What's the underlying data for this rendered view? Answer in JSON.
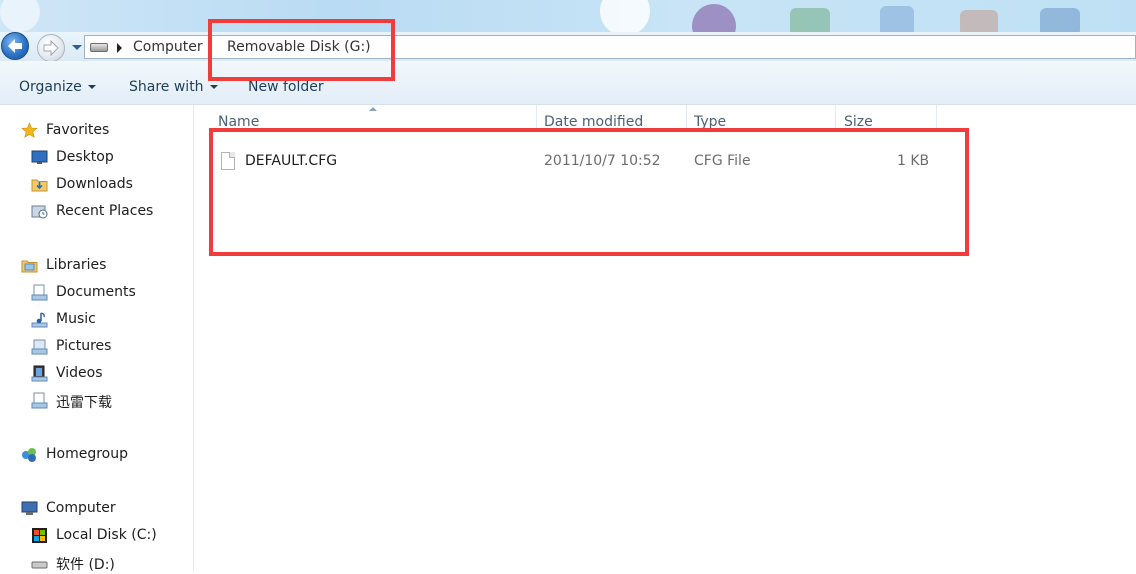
{
  "address": {
    "crumbs": [
      "Computer",
      "Removable Disk (G:)"
    ]
  },
  "toolbar": {
    "organize_label": "Organize",
    "share_label": "Share with",
    "new_folder_label": "New folder"
  },
  "sidebar": {
    "favorites": {
      "label": "Favorites",
      "items": [
        {
          "label": "Desktop",
          "icon": "desktop-icon"
        },
        {
          "label": "Downloads",
          "icon": "downloads-folder-icon"
        },
        {
          "label": "Recent Places",
          "icon": "recent-places-icon"
        }
      ]
    },
    "libraries": {
      "label": "Libraries",
      "items": [
        {
          "label": "Documents",
          "icon": "documents-icon"
        },
        {
          "label": "Music",
          "icon": "music-icon"
        },
        {
          "label": "Pictures",
          "icon": "pictures-icon"
        },
        {
          "label": "Videos",
          "icon": "videos-icon"
        },
        {
          "label": "迅雷下载",
          "icon": "download-library-icon"
        }
      ]
    },
    "homegroup": {
      "label": "Homegroup"
    },
    "computer": {
      "label": "Computer",
      "items": [
        {
          "label": "Local Disk (C:)",
          "icon": "local-disk-icon"
        },
        {
          "label": "软件 (D:)",
          "icon": "drive-icon"
        }
      ]
    }
  },
  "columns": {
    "name": "Name",
    "date": "Date modified",
    "type": "Type",
    "size": "Size"
  },
  "files": [
    {
      "name": "DEFAULT.CFG",
      "date": "2011/10/7 10:52",
      "type": "CFG File",
      "size": "1 KB"
    }
  ],
  "colors": {
    "highlight": "#f03c3c",
    "toolbar_text": "#1e3d5c",
    "column_header_text": "#4c607a"
  }
}
